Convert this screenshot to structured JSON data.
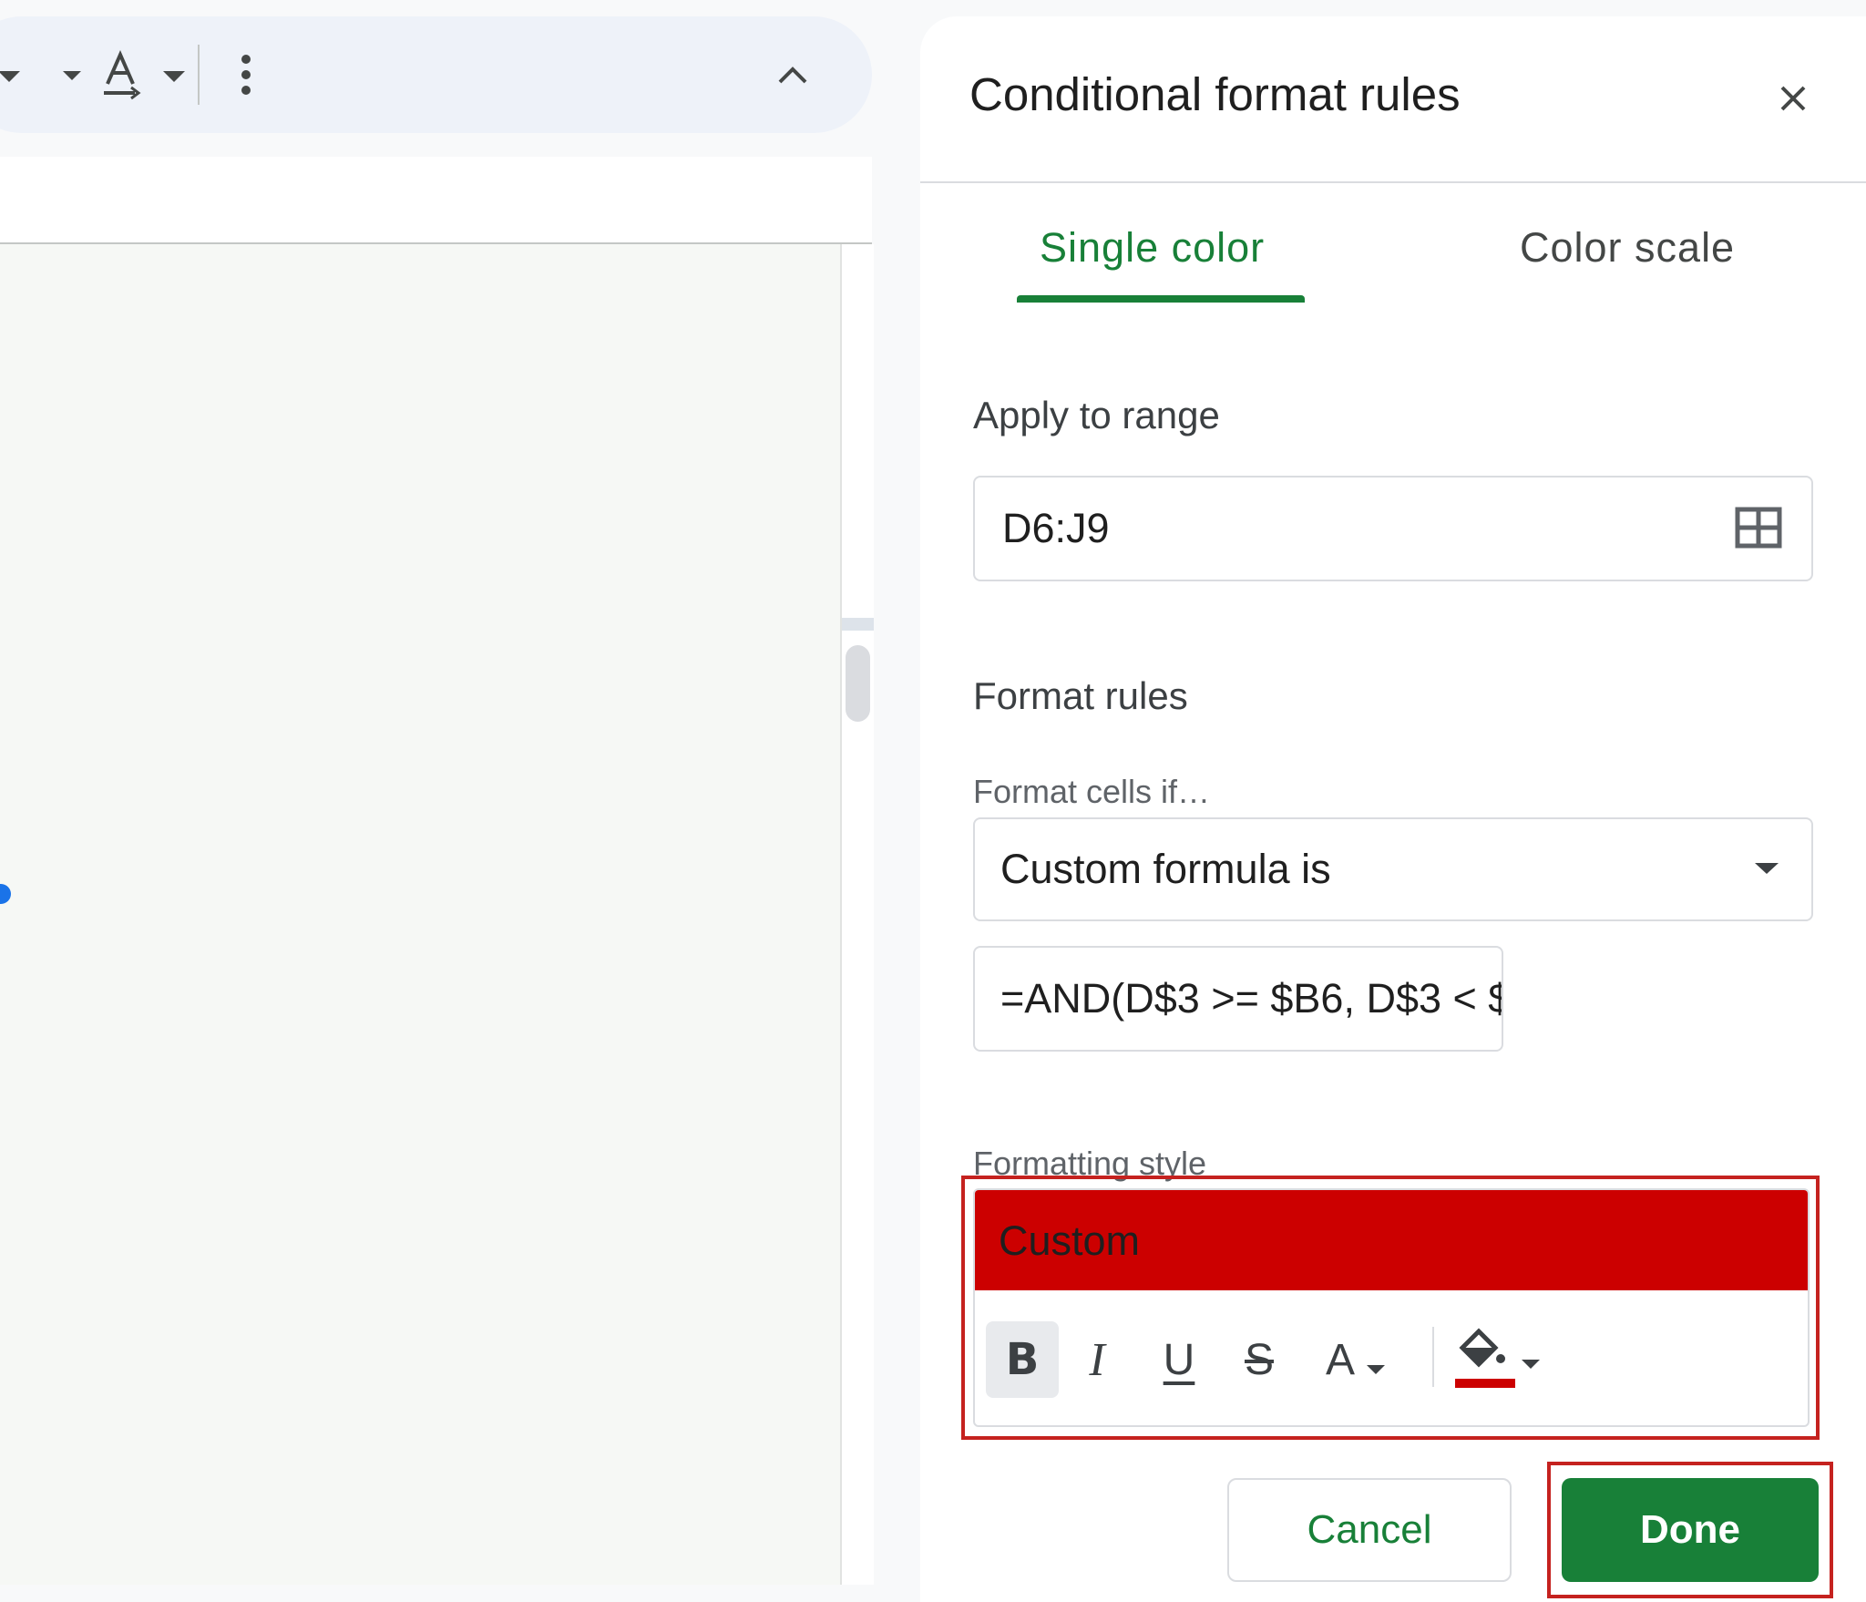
{
  "panel": {
    "title": "Conditional format rules",
    "tabs": [
      {
        "label": "Single color",
        "active": true
      },
      {
        "label": "Color scale",
        "active": false
      }
    ],
    "apply_to_range": {
      "label": "Apply to range",
      "value": "D6:J9"
    },
    "format_rules": {
      "label": "Format rules",
      "condition_label": "Format cells if…",
      "condition_value": "Custom formula is",
      "formula_value": "=AND(D$3 >= $B6, D$3 < $"
    },
    "formatting_style": {
      "label": "Formatting style",
      "preview_text": "Custom",
      "fill_color": "#cc0000",
      "toolbar": {
        "bold": "B",
        "italic": "I",
        "underline": "U",
        "strikethrough": "S",
        "text_color": "A"
      }
    },
    "buttons": {
      "cancel": "Cancel",
      "done": "Done"
    }
  },
  "colors": {
    "accent": "#188038",
    "highlight": "#c5221f",
    "preview_fill": "#cc0000"
  }
}
